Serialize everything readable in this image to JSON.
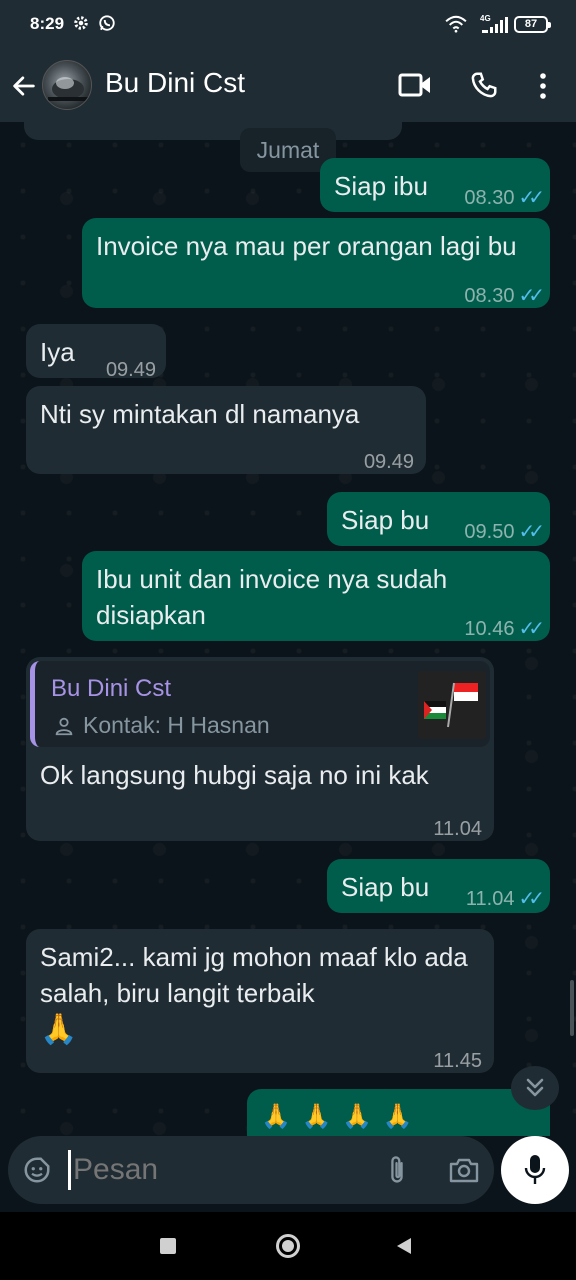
{
  "status_bar": {
    "time": "8:29",
    "network": "4G",
    "battery": "87"
  },
  "header": {
    "contact_name": "Bu Dini Cst"
  },
  "chat": {
    "date_chip": "Jumat",
    "messages": [
      {
        "dir": "out",
        "text": "Siap ibu",
        "time": "08.30"
      },
      {
        "dir": "out",
        "text": "Invoice nya mau per orangan lagi bu",
        "time": "08.30"
      },
      {
        "dir": "in",
        "text": "Iya",
        "time": "09.49"
      },
      {
        "dir": "in",
        "text": "Nti sy mintakan dl namanya",
        "time": "09.49"
      },
      {
        "dir": "out",
        "text": "Siap bu",
        "time": "09.50"
      },
      {
        "dir": "out",
        "text": "Ibu unit dan invoice nya sudah disiapkan",
        "time": "10.46"
      },
      {
        "dir": "in",
        "text": "Ok langsung hubgi saja no ini kak",
        "time": "11.04",
        "reply": {
          "name": "Bu Dini Cst",
          "subtitle": "Kontak: H Hasnan"
        }
      },
      {
        "dir": "out",
        "text": "Siap bu",
        "time": "11.04"
      },
      {
        "dir": "in",
        "text": "Sami2... kami jg mohon maaf klo ada salah, biru langit terbaik",
        "emoji": "🙏",
        "time": "11.45"
      },
      {
        "dir": "out",
        "text": "🙏 🙏 🙏 🙏"
      }
    ]
  },
  "input": {
    "placeholder": "Pesan"
  },
  "icons": {
    "back": "back-arrow-icon",
    "video": "video-call-icon",
    "call": "phone-icon",
    "menu": "more-vert-icon",
    "sticker": "sticker-icon",
    "attach": "paperclip-icon",
    "camera": "camera-icon",
    "mic": "mic-icon",
    "scroll": "double-chevron-down-icon"
  },
  "colors": {
    "outgoing": "#005c4b",
    "incoming": "#202c33",
    "background": "#0b141a",
    "ticks": "#53bdeb",
    "reply_name": "#a793e6"
  }
}
